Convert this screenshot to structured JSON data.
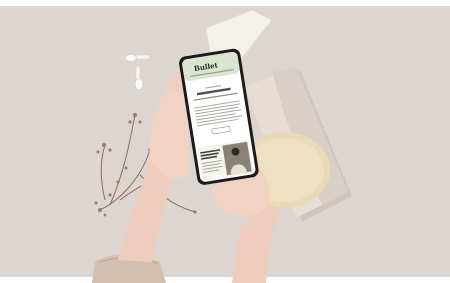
{
  "screen": {
    "brand_title": "Bullet",
    "header_subtitle": "",
    "body_heading": "",
    "card_heading": ""
  },
  "colors": {
    "background": "#ddd5d0",
    "phone_header": "#dbe4cf",
    "phone_frame": "#1b1b1b",
    "sweater": "#d2bfb0",
    "skin": "#f1d1c2"
  }
}
